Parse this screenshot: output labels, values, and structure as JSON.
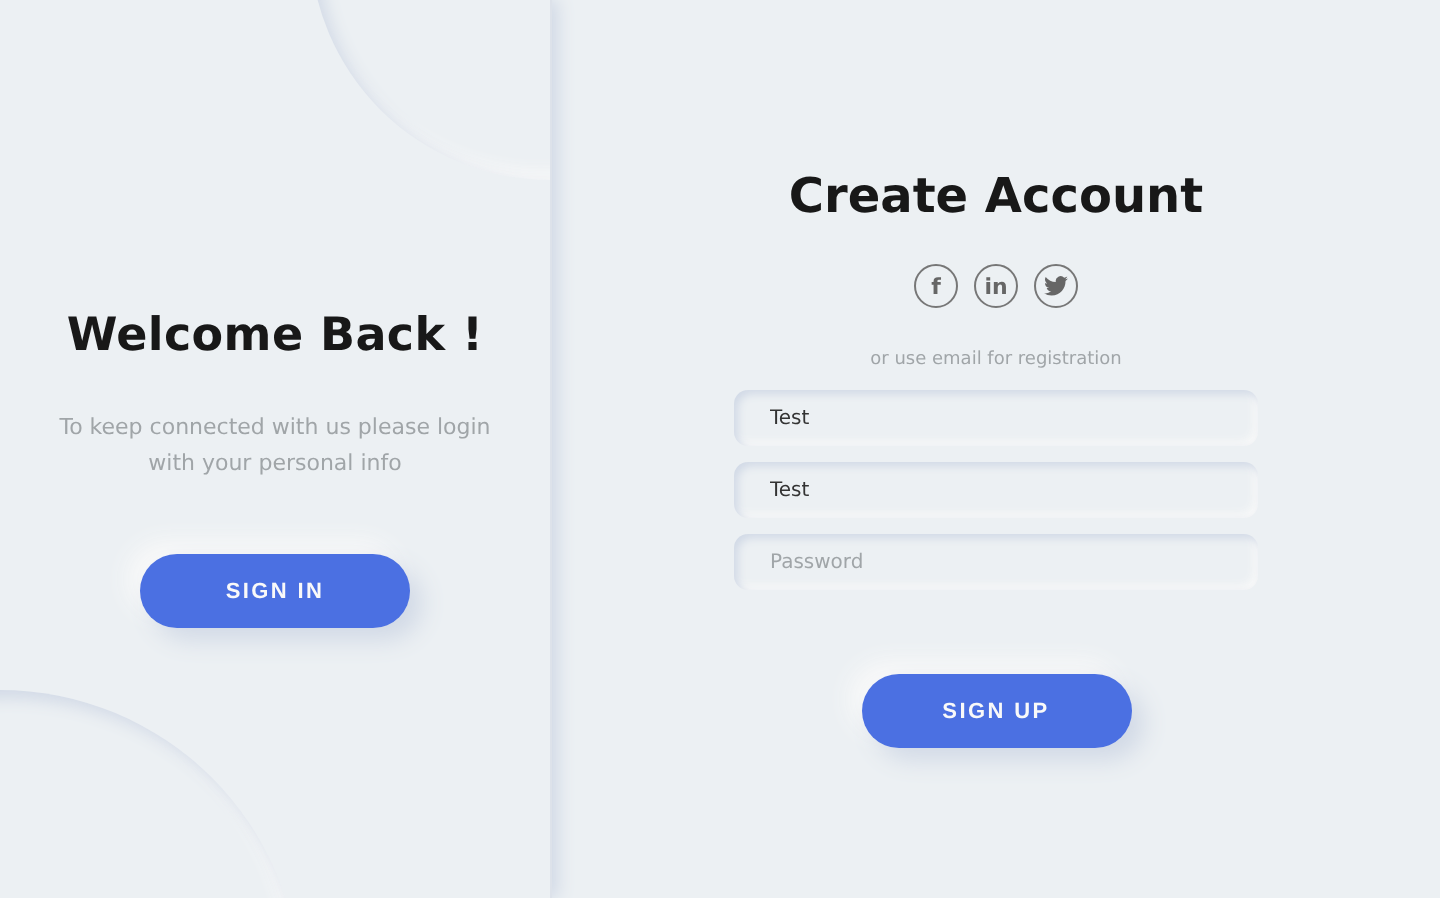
{
  "left_panel": {
    "title": "Welcome Back !",
    "text": "To keep connected with us please login with your personal info",
    "button": "SIGN IN"
  },
  "form": {
    "title": "Create Account",
    "socials": [
      {
        "kind": "letter",
        "label": "f"
      },
      {
        "kind": "letter",
        "label": "in"
      },
      {
        "kind": "bird"
      }
    ],
    "hint": "or use email for registration",
    "fields": [
      {
        "value": "Test"
      },
      {
        "value": "Test"
      },
      {
        "placeholder": "Password"
      }
    ],
    "button": "SIGN UP"
  }
}
